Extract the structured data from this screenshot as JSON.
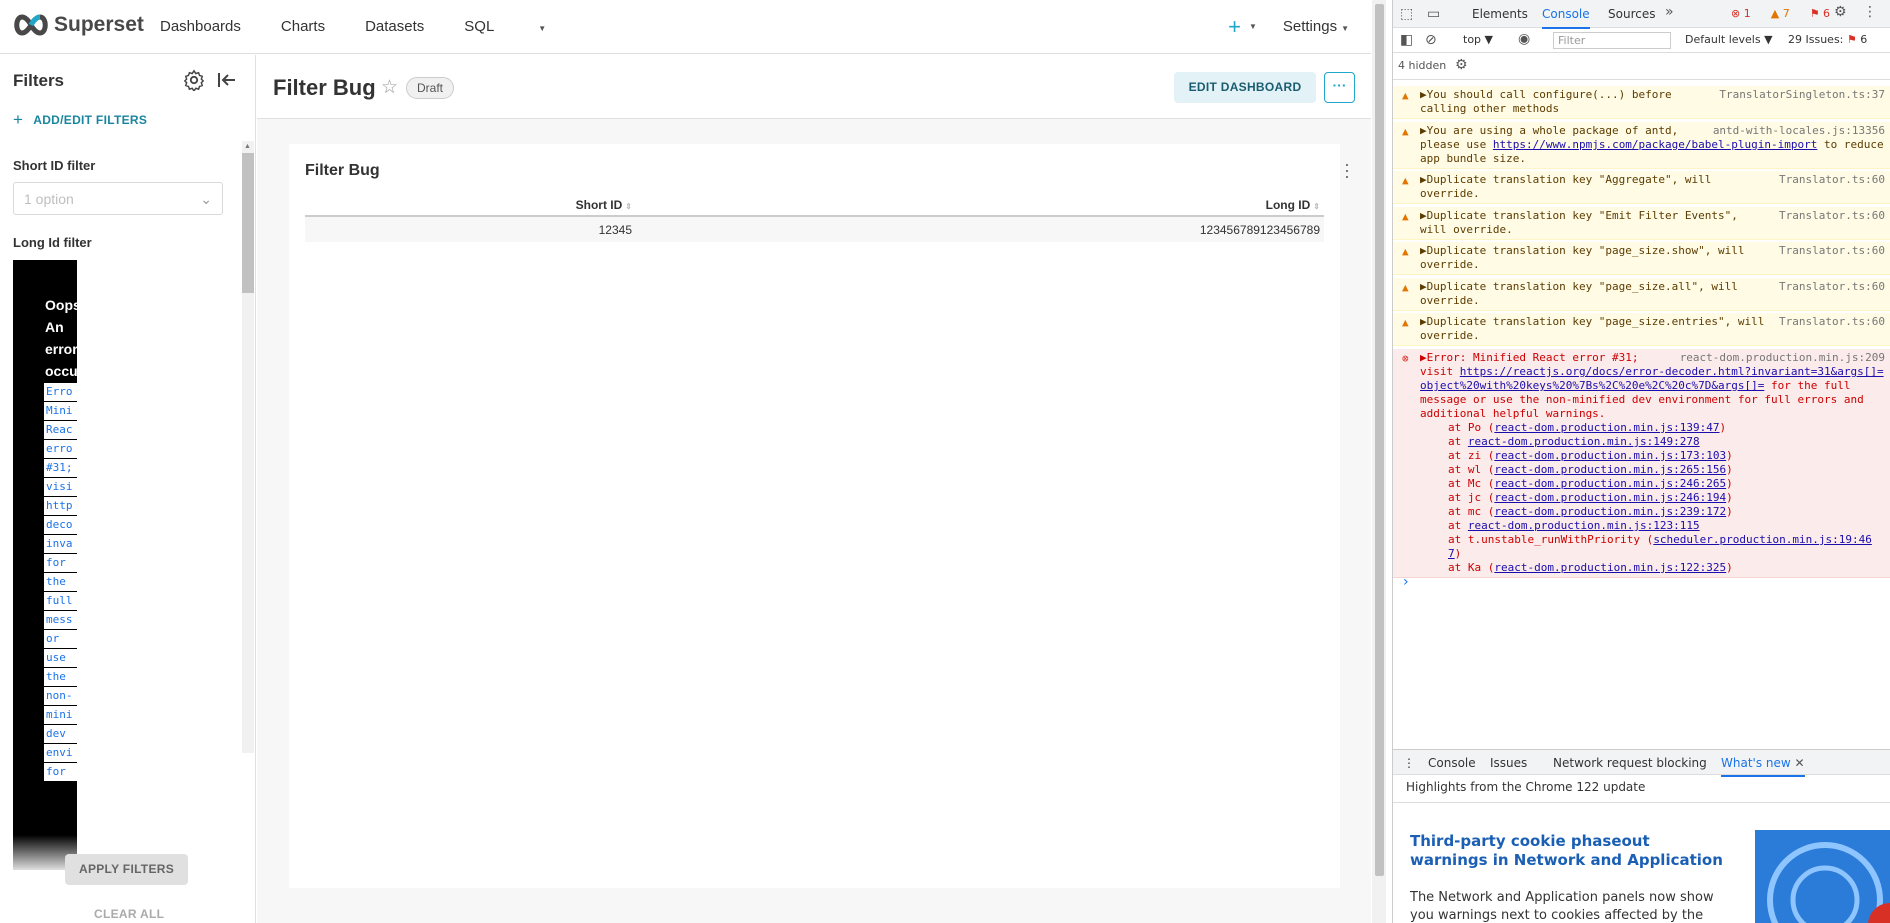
{
  "nav": {
    "brand": "Superset",
    "links": [
      "Dashboards",
      "Charts",
      "Datasets",
      "SQL"
    ],
    "plus_icon": "+",
    "settings": "Settings"
  },
  "filters": {
    "title": "Filters",
    "add_edit": "ADD/EDIT FILTERS",
    "short_label": "Short ID filter",
    "short_placeholder": "1 option",
    "long_label": "Long Id filter",
    "error_heading": [
      "Oops!",
      "An",
      "error",
      "occu"
    ],
    "error_words": [
      "Erro",
      "Mini",
      "Reac",
      "erro",
      "#31;",
      "visi",
      "http",
      "deco",
      "inva",
      "for",
      "the",
      "full",
      "mess",
      "or",
      "use",
      "the",
      "non-",
      "mini",
      "dev",
      "envi",
      "for"
    ],
    "apply": "APPLY FILTERS",
    "clear": "CLEAR ALL"
  },
  "dashboard": {
    "title": "Filter Bug",
    "draft": "Draft",
    "edit_button": "EDIT DASHBOARD",
    "more_button": "···"
  },
  "chart": {
    "title": "Filter Bug",
    "columns": [
      "Short ID",
      "Long ID"
    ],
    "rows": [
      [
        "12345",
        "123456789123456789"
      ]
    ]
  },
  "devtools": {
    "tabs": [
      "Elements",
      "Console",
      "Sources"
    ],
    "badges": {
      "errors": "1",
      "warnings": "7",
      "issues_flag": "6"
    },
    "context": "top",
    "filter_placeholder": "Filter",
    "levels": "Default levels",
    "issues": "29 Issues:",
    "issues_count": "6",
    "hidden": "4 hidden",
    "messages": [
      {
        "type": "warn",
        "text": "▶You should call configure(...) before\ncalling other methods",
        "src": "TranslatorSingleton.ts:37"
      },
      {
        "type": "warn",
        "text": "▶You are using a whole package of antd,\nplease use ",
        "link": "https://www.npmjs.com/package/babel-plugin-import",
        "tail": " to reduce\napp bundle size.",
        "src": "antd-with-locales.js:13356"
      },
      {
        "type": "warn",
        "text": "▶Duplicate translation key \"Aggregate\", will\noverride.",
        "src": "Translator.ts:60"
      },
      {
        "type": "warn",
        "text": "▶Duplicate translation key \"Emit Filter Events\",\nwill override.",
        "src": "Translator.ts:60"
      },
      {
        "type": "warn",
        "text": "▶Duplicate translation key \"page_size.show\", will\noverride.",
        "src": "Translator.ts:60"
      },
      {
        "type": "warn",
        "text": "▶Duplicate translation key \"page_size.all\", will\noverride.",
        "src": "Translator.ts:60"
      },
      {
        "type": "warn",
        "text": "▶Duplicate translation key \"page_size.entries\", will\noverride.",
        "src": "Translator.ts:60"
      }
    ],
    "error": {
      "text": "▶Error: Minified React error #31;",
      "src": "react-dom.production.min.js:209",
      "visit": "visit ",
      "link": "https://reactjs.org/docs/error-decoder.html?invariant=31&args[]=object%20with%20keys%20%7Bs%2C%20e%2C%20c%7D&args[]=",
      "tail": " for the full\nmessage or use the non-minified dev environment for full errors and\nadditional helpful warnings.",
      "stack": [
        [
          "at Po (",
          "react-dom.production.min.js:139:47",
          ")"
        ],
        [
          "at ",
          "react-dom.production.min.js:149:278",
          ""
        ],
        [
          "at zi (",
          "react-dom.production.min.js:173:103",
          ")"
        ],
        [
          "at wl (",
          "react-dom.production.min.js:265:156",
          ")"
        ],
        [
          "at Mc (",
          "react-dom.production.min.js:246:265",
          ")"
        ],
        [
          "at jc (",
          "react-dom.production.min.js:246:194",
          ")"
        ],
        [
          "at mc (",
          "react-dom.production.min.js:239:172",
          ")"
        ],
        [
          "at ",
          "react-dom.production.min.js:123:115",
          ""
        ],
        [
          "at t.unstable_runWithPriority (",
          "scheduler.production.min.js:19:467",
          ")"
        ],
        [
          "at Ka (",
          "react-dom.production.min.js:122:325",
          ")"
        ]
      ]
    },
    "drawer_tabs": [
      "Console",
      "Issues",
      "Network request blocking",
      "What's new"
    ],
    "whats_new": {
      "highlights": "Highlights from the Chrome 122 update",
      "title": "Third-party cookie phaseout warnings in Network and Application",
      "body": "The Network and Application panels now show you warnings next to cookies affected by the"
    }
  }
}
